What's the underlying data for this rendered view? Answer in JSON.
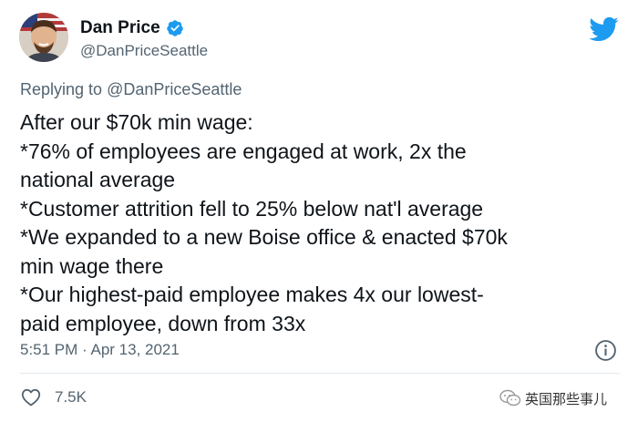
{
  "author": {
    "display_name": "Dan Price",
    "handle": "@DanPriceSeattle",
    "verified": true
  },
  "reply": {
    "prefix": "Replying to",
    "mention": "@DanPriceSeattle"
  },
  "tweet": {
    "lines": [
      "After our $70k min wage:",
      "*76% of employees are engaged at work, 2x the",
      "national average",
      "*Customer attrition fell to 25% below nat'l average",
      "*We expanded to a new Boise office & enacted $70k",
      "min wage there",
      "*Our highest-paid employee makes 4x our lowest-",
      "paid employee, down from 33x"
    ],
    "timestamp": "5:51 PM · Apr 13, 2021"
  },
  "engagement": {
    "likes": "7.5K"
  },
  "watermark": {
    "text": "英国那些事儿"
  },
  "icons": {
    "verified": "verified-badge-icon",
    "logo": "twitter-bird-icon",
    "info": "info-icon",
    "like": "heart-icon",
    "watermark": "wechat-icon"
  },
  "colors": {
    "brand": "#1d9bf0",
    "text": "#0f1419",
    "secondary": "#536471"
  }
}
